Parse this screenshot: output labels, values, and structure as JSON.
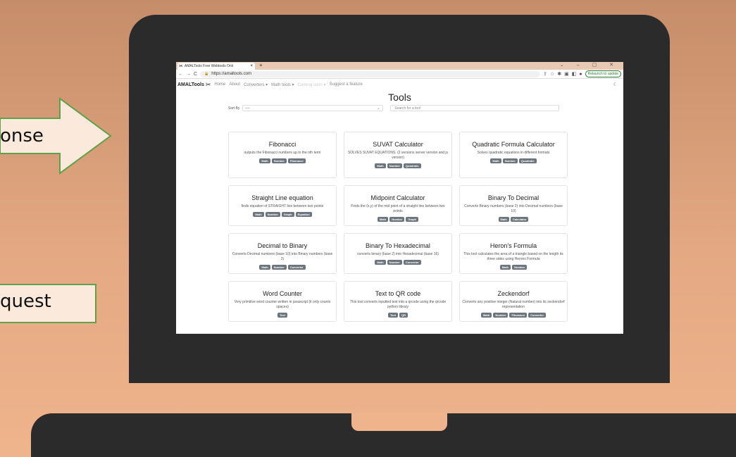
{
  "slide": {
    "arrow_label": "onse",
    "request_label": "quest"
  },
  "browser": {
    "tab_title": "AMALTools Free Webtools Onli",
    "tab_close": "×",
    "new_tab": "+",
    "window_controls": "⌄ – ▢ ✕",
    "url": "https://amaltools.com",
    "relaunch_label": "Relaunch to update"
  },
  "site": {
    "brand": "AMALTools",
    "nav": [
      "Home",
      "About",
      "Converters ▾",
      "Math tools ▾",
      "Coming soon ▾",
      "Suggest a feature"
    ],
    "heading": "Tools",
    "sort_label": "Sort By",
    "sort_value": "----",
    "search_placeholder": "Search for a tool"
  },
  "tools": [
    {
      "title": "Fibonacci",
      "desc": "outputs the Fibonacci numbers up to the nth term",
      "tags": [
        "Math",
        "Number",
        "Fibonacci"
      ]
    },
    {
      "title": "SUVAT Calculator",
      "desc": "SOLVES SUVAT EQUATIONS. (2 versions server version and js version)",
      "tags": [
        "Math",
        "Number",
        "Quadratic"
      ]
    },
    {
      "title": "Quadratic Formula Calculator",
      "desc": "Solves quadratic equations in different formats",
      "tags": [
        "Math",
        "Number",
        "Quadratic"
      ]
    },
    {
      "title": "Straight Line equation",
      "desc": "finds equation of STRAIGHT line between two points",
      "tags": [
        "Math",
        "Number",
        "Graph",
        "Equation"
      ]
    },
    {
      "title": "Midpoint Calculator",
      "desc": "Finds the (x,y) of the mid point of a straight line between two points",
      "tags": [
        "Math",
        "Number",
        "Graph"
      ]
    },
    {
      "title": "Binary To Decimal",
      "desc": "Converts Binary numbers (base 2) into Decimal numbers (base 10)",
      "tags": [
        "Math",
        "Calculator"
      ]
    },
    {
      "title": "Decimal to Binary",
      "desc": "Converts Decimal numbers (base 10) into Binary numbers (base 2)",
      "tags": [
        "Math",
        "Number",
        "Converter"
      ]
    },
    {
      "title": "Binary To Hexadecimal",
      "desc": "converts binary (base 2) into Hexadecimal (base 16)",
      "tags": [
        "Math",
        "Number",
        "Converter"
      ]
    },
    {
      "title": "Heron's Formula",
      "desc": "This tool calculates the area of a triangle based on the length its three sides using Herons Formula",
      "tags": [
        "Math",
        "Number"
      ]
    },
    {
      "title": "Word Counter",
      "desc": "Very primitive word counter written in javascript (it only counts spaces)",
      "tags": [
        "Text"
      ]
    },
    {
      "title": "Text to QR code",
      "desc": "This tool converts inputted text into a qrcode using the qrcode python library",
      "tags": [
        "Text",
        "QR"
      ]
    },
    {
      "title": "Zeckendorf",
      "desc": "Converts any positive integer (Natural number) into its zeckendorf representation",
      "tags": [
        "Math",
        "Number",
        "Fibonacci",
        "Converter"
      ]
    }
  ]
}
